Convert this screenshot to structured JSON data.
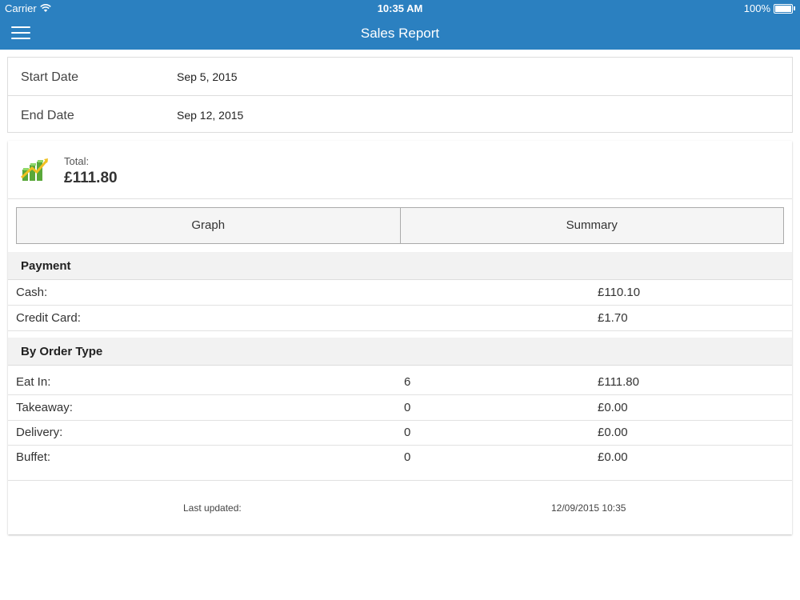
{
  "status_bar": {
    "carrier": "Carrier",
    "time": "10:35 AM",
    "battery": "100%"
  },
  "nav": {
    "title": "Sales Report",
    "menu_icon": "hamburger-menu-icon"
  },
  "dates": {
    "start_label": "Start Date",
    "start_value": "Sep 5, 2015",
    "end_label": "End Date",
    "end_value": "Sep 12, 2015"
  },
  "total": {
    "icon": "sales-chart-icon",
    "label": "Total:",
    "value": "£111.80"
  },
  "tabs": {
    "graph": "Graph",
    "summary": "Summary"
  },
  "payment": {
    "heading": "Payment",
    "rows": [
      {
        "name": "Cash:",
        "amount": "£110.10"
      },
      {
        "name": "Credit Card:",
        "amount": "£1.70"
      }
    ]
  },
  "order_type": {
    "heading": "By Order Type",
    "rows": [
      {
        "name": "Eat In:",
        "count": "6",
        "amount": "£111.80"
      },
      {
        "name": "Takeaway:",
        "count": "0",
        "amount": "£0.00"
      },
      {
        "name": "Delivery:",
        "count": "0",
        "amount": "£0.00"
      },
      {
        "name": "Buffet:",
        "count": "0",
        "amount": "£0.00"
      }
    ]
  },
  "footer": {
    "label": "Last updated:",
    "value": "12/09/2015 10:35"
  },
  "colors": {
    "nav_bar": "#2b80c0",
    "section_bg": "#f2f2f2",
    "icon_green": "#6cc04a",
    "icon_arrow": "#f0c020"
  }
}
